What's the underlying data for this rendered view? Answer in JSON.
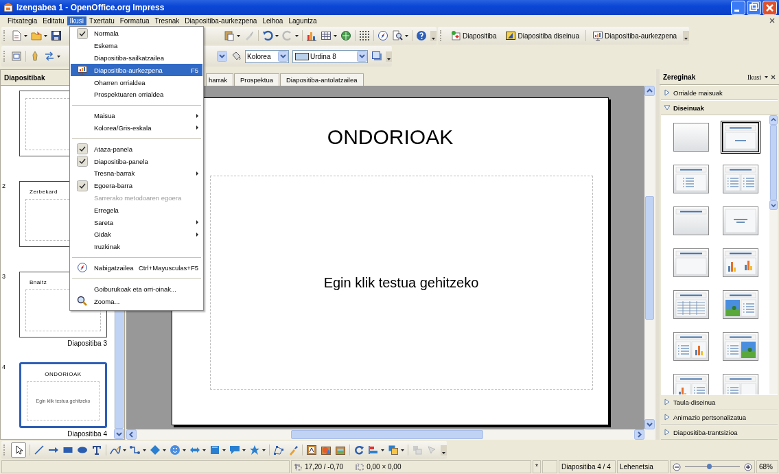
{
  "window": {
    "title": "Izengabea 1 - OpenOffice.org Impress"
  },
  "menu_bar": {
    "items": [
      {
        "label": "Fitxategia",
        "selected": false
      },
      {
        "label": "Editatu",
        "selected": false
      },
      {
        "label": "Ikusi",
        "selected": true
      },
      {
        "label": "Txertatu",
        "selected": false
      },
      {
        "label": "Formatua",
        "selected": false
      },
      {
        "label": "Tresnak",
        "selected": false
      },
      {
        "label": "Diapositiba-aurkezpena",
        "selected": false
      },
      {
        "label": "Leihoa",
        "selected": false
      },
      {
        "label": "Laguntza",
        "selected": false
      }
    ]
  },
  "standard_toolbar": {
    "buttons": [
      {
        "label": "Diapositiba"
      },
      {
        "label": "Diapositiba diseinua"
      },
      {
        "label": "Diapositiba-aurkezpena"
      }
    ]
  },
  "line_toolbar": {
    "area_style": "Kolorea",
    "area_color": "Urdina 8"
  },
  "slides_panel": {
    "title": "Diapositibak",
    "slides": [
      {
        "selected": false
      },
      {
        "number": "2",
        "title": "Zerbekard",
        "selected": false
      },
      {
        "number": "3",
        "title": "Bnaltz",
        "label": "Diapositiba 3",
        "selected": false
      },
      {
        "number": "4",
        "title": "ONDORIOAK",
        "body": "Egin klik testua gehitzeko",
        "label": "Diapositiba 4",
        "selected": true
      }
    ]
  },
  "view_tabs": [
    {
      "label": "harrak",
      "selected": false
    },
    {
      "label": "Prospektua",
      "selected": false
    },
    {
      "label": "Diapositiba-antolatzailea",
      "selected": false
    }
  ],
  "slide": {
    "title": "ONDORIOAK",
    "body": "Egin klik testua gehitzeko"
  },
  "task_pane": {
    "title": "Zereginak",
    "view_button": "Ikusi",
    "sections": [
      {
        "label": "Orrialde maisuak",
        "expanded": false
      },
      {
        "label": "Diseinuak",
        "expanded": true,
        "layouts": [
          {
            "kind": "blank",
            "selected": false
          },
          {
            "kind": "title-subtitle",
            "selected": true
          },
          {
            "kind": "title-bullets",
            "selected": false
          },
          {
            "kind": "two-bullets",
            "selected": false
          },
          {
            "kind": "title-only",
            "selected": false
          },
          {
            "kind": "centered",
            "selected": false
          },
          {
            "kind": "title-box",
            "selected": false
          },
          {
            "kind": "chart",
            "selected": false
          },
          {
            "kind": "table",
            "selected": false
          },
          {
            "kind": "picture-bullets",
            "selected": false
          },
          {
            "kind": "bullets-chart",
            "selected": false
          },
          {
            "kind": "bullets-picture",
            "selected": false
          },
          {
            "kind": "chart-bullets",
            "selected": false
          },
          {
            "kind": "bullets-box",
            "selected": false
          }
        ]
      },
      {
        "label": "Taula-diseinua",
        "expanded": false
      },
      {
        "label": "Animazio pertsonalizatua",
        "expanded": false
      },
      {
        "label": "Diapositiba-trantsizioa",
        "expanded": false
      }
    ]
  },
  "view_menu": {
    "items": [
      {
        "kind": "toggle",
        "label": "Normala",
        "checked": true,
        "selected": false
      },
      {
        "kind": "command",
        "label": "Eskema",
        "selected": false
      },
      {
        "kind": "command",
        "label": "Diapositiba-sailkatzailea",
        "selected": false
      },
      {
        "kind": "command",
        "label": "Diapositiba-aurkezpena",
        "shortcut": "F5",
        "selected": true
      },
      {
        "kind": "command",
        "label": "Oharren orrialdea",
        "selected": false
      },
      {
        "kind": "command",
        "label": "Prospektuaren orrialdea",
        "selected": false
      },
      {
        "kind": "separator"
      },
      {
        "kind": "submenu",
        "label": "Maisua",
        "selected": false
      },
      {
        "kind": "submenu",
        "label": "Kolorea/Gris-eskala",
        "selected": false
      },
      {
        "kind": "separator"
      },
      {
        "kind": "toggle",
        "label": "Ataza-panela",
        "checked": true,
        "selected": false
      },
      {
        "kind": "toggle",
        "label": "Diapositiba-panela",
        "checked": true,
        "selected": false
      },
      {
        "kind": "submenu",
        "label": "Tresna-barrak",
        "selected": false
      },
      {
        "kind": "toggle",
        "label": "Egoera-barra",
        "checked": true,
        "selected": false
      },
      {
        "kind": "command",
        "label": "Sarrerako metodoaren egoera",
        "disabled": true,
        "selected": false
      },
      {
        "kind": "command",
        "label": "Erregela",
        "selected": false
      },
      {
        "kind": "submenu",
        "label": "Sareta",
        "selected": false
      },
      {
        "kind": "submenu",
        "label": "Gidak",
        "selected": false
      },
      {
        "kind": "command",
        "label": "Iruzkinak",
        "selected": false
      },
      {
        "kind": "separator"
      },
      {
        "kind": "command",
        "label": "Nabigatzailea",
        "shortcut": "Ctrl+Mayusculas+F5",
        "selected": false
      },
      {
        "kind": "separator"
      },
      {
        "kind": "command",
        "label": "Goiburukoak eta orri-oinak...",
        "selected": false
      },
      {
        "kind": "command",
        "label": "Zooma...",
        "selected": false
      }
    ]
  },
  "status_bar": {
    "position": "17,20 / -0,70",
    "size": "0,00 × 0,00",
    "modified": "*",
    "slide": "Diapositiba 4 / 4",
    "master": "Lehenetsia",
    "zoom": {
      "level": 0.45,
      "reading": "68%"
    }
  }
}
